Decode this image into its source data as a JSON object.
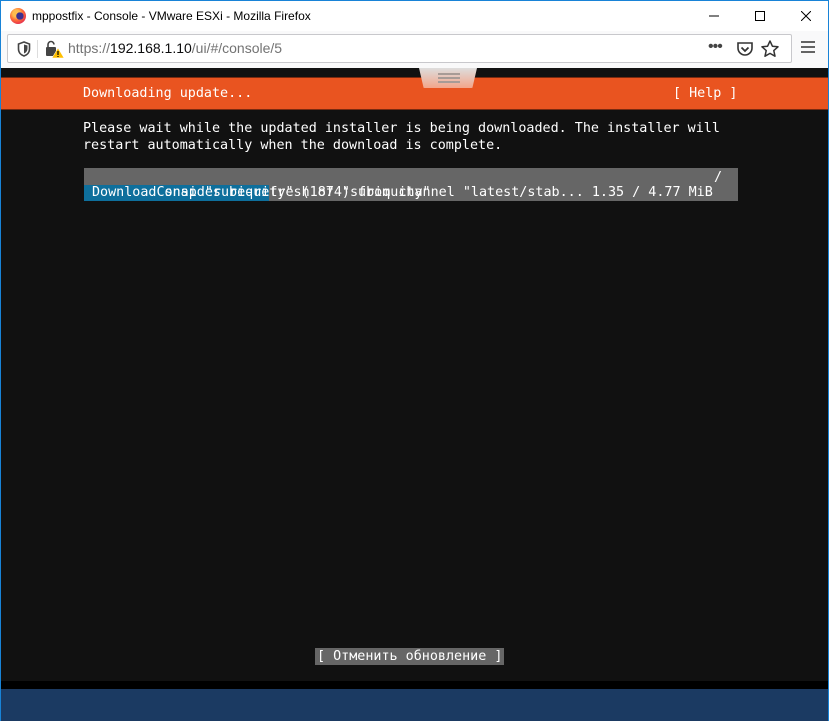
{
  "window": {
    "title": "mppostfix - Console - VMware ESXi - Mozilla Firefox",
    "controls": {
      "minimize": "—",
      "maximize": "☐",
      "close": "✕"
    }
  },
  "navbar": {
    "url_scheme": "https://",
    "url_host": "192.168.1.10",
    "url_path": "/ui/#/console/5",
    "icons": [
      "shield-icon",
      "insecure-lock-icon",
      "page-actions-icon",
      "pocket-icon",
      "bookmark-star-icon",
      "hamburger-menu-icon"
    ],
    "more_label": "•••"
  },
  "console": {
    "header_title": "Downloading update...",
    "help_label": "[ Help ]",
    "message_line1": "Please wait while the updated installer is being downloaded. The installer will",
    "message_line2": "restart automatically when the download is complete.",
    "task_line": "Consider re-refresh of \"subiquity\"",
    "spinner": "/",
    "download_line": "Download snap \"subiquity\" (1874) from channel \"latest/stab... 1.35 / 4.77 MiB",
    "download": {
      "done_mib": 1.35,
      "total_mib": 4.77,
      "fraction": 0.283
    },
    "cancel_label": "[ Отменить обновление ]",
    "colors": {
      "header": "#e95420",
      "progress_fill": "#0e6f9c",
      "progress_bg": "#666666",
      "background": "#111111",
      "bottom_bar": "#1b3a62"
    }
  }
}
